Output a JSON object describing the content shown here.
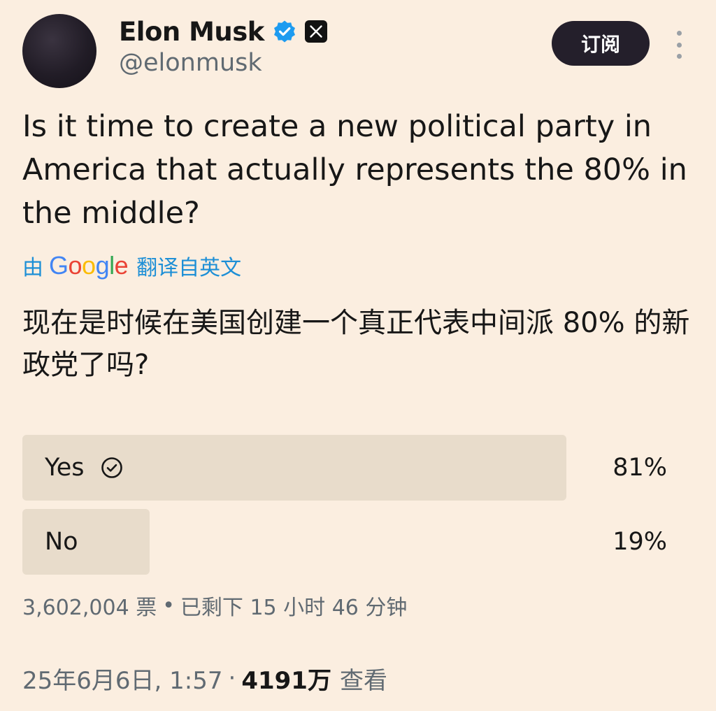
{
  "author": {
    "display_name": "Elon Musk",
    "handle": "@elonmusk"
  },
  "header": {
    "subscribe_label": "订阅"
  },
  "tweet": {
    "text": "Is it time to create a new political party in America that actually represents the 80% in the middle?",
    "translation": {
      "prefix": "由",
      "provider": "Google",
      "suffix": "翻译自英文",
      "text": "现在是时候在美国创建一个真正代表中间派 80% 的新政党了吗?"
    }
  },
  "poll": {
    "options": [
      {
        "label": "Yes",
        "percent_label": "81%",
        "fraction": 0.81,
        "selected": true
      },
      {
        "label": "No",
        "percent_label": "19%",
        "fraction": 0.19,
        "selected": false
      }
    ],
    "votes_label": "3,602,004 票",
    "time_left_label": "已剩下 15 小时 46 分钟"
  },
  "meta": {
    "timestamp": "25年6月6日, 1:57",
    "views_count": "4191万",
    "views_label": "查看"
  },
  "colors": {
    "background": "#fbeee0",
    "verified": "#1d9bf0",
    "poll_bar": "#e8dccb",
    "subscribe_bg": "#241f2b",
    "translate_link": "#1d8fd6"
  },
  "icons": {
    "verified": "verified-badge-icon",
    "x_logo": "x-logo-icon",
    "more": "more-vertical-icon",
    "check": "check-circle-icon"
  }
}
